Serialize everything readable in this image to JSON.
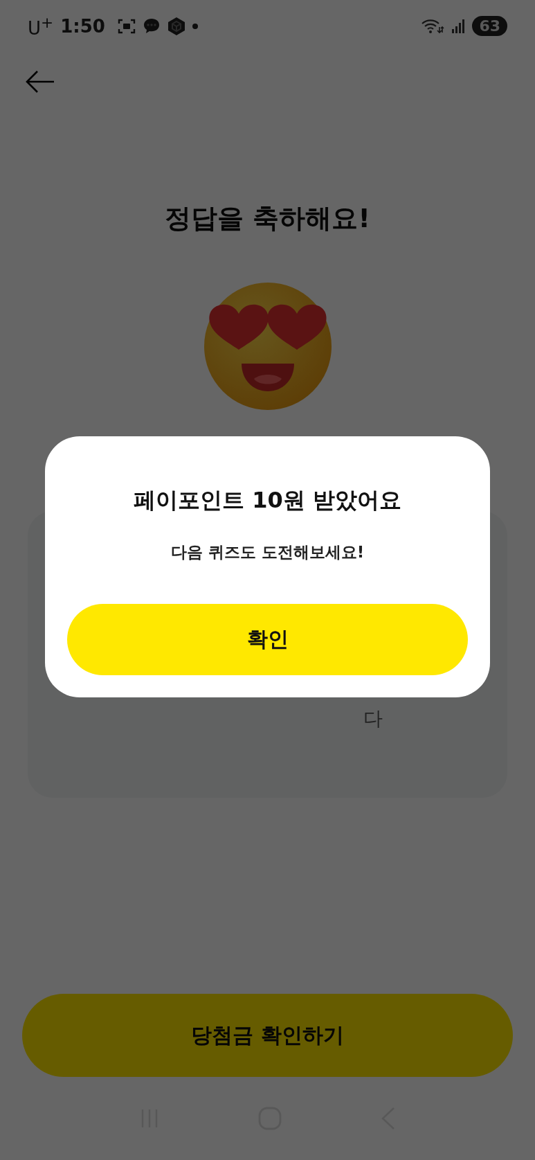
{
  "status_bar": {
    "carrier": "U$^{+}$",
    "time": "1:50",
    "battery": "63"
  },
  "title": "정답을 축하해요!",
  "answer_card": {
    "suffix": "다"
  },
  "primary_button": "당첨금 확인하기",
  "dialog": {
    "title": "페이포인트 10원 받았어요",
    "message": "다음 퀴즈도 도전해보세요!",
    "confirm": "확인"
  }
}
